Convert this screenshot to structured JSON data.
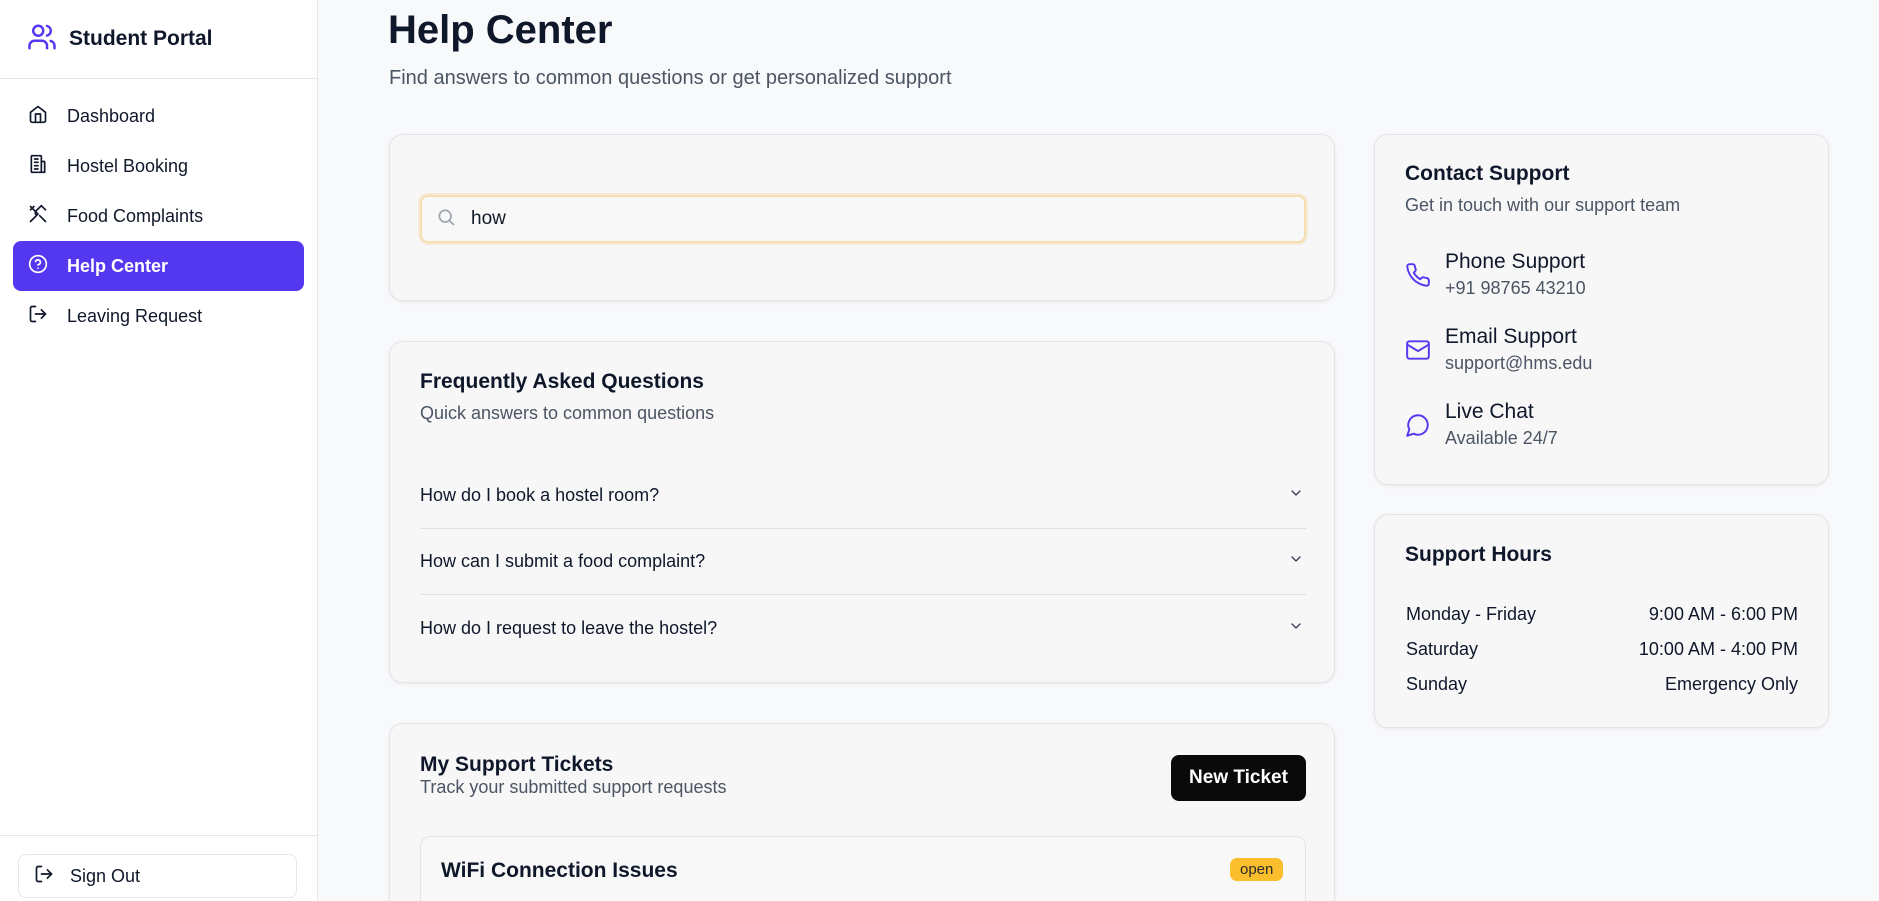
{
  "app": {
    "title": "Student Portal"
  },
  "colors": {
    "accent": "#5438f0",
    "badge_open": "#fbbf2e"
  },
  "sidebar": {
    "items": [
      {
        "label": "Dashboard",
        "icon": "home-icon",
        "active": false
      },
      {
        "label": "Hostel Booking",
        "icon": "building-icon",
        "active": false
      },
      {
        "label": "Food Complaints",
        "icon": "utensils-crossed-icon",
        "active": false
      },
      {
        "label": "Help Center",
        "icon": "help-circle-icon",
        "active": true
      },
      {
        "label": "Leaving Request",
        "icon": "log-out-icon",
        "active": false
      }
    ],
    "signout_label": "Sign Out"
  },
  "header": {
    "title": "Help Center",
    "subtitle": "Find answers to common questions or get personalized support"
  },
  "search": {
    "value": "how"
  },
  "faq": {
    "title": "Frequently Asked Questions",
    "subtitle": "Quick answers to common questions",
    "items": [
      "How do I book a hostel room?",
      "How can I submit a food complaint?",
      "How do I request to leave the hostel?"
    ]
  },
  "tickets": {
    "title": "My Support Tickets",
    "subtitle": "Track your submitted support requests",
    "new_button": "New Ticket",
    "items": [
      {
        "title": "WiFi Connection Issues",
        "status": "open"
      }
    ]
  },
  "contact": {
    "title": "Contact Support",
    "subtitle": "Get in touch with our support team",
    "items": [
      {
        "name": "Phone Support",
        "detail": "+91 98765 43210",
        "icon": "phone-icon"
      },
      {
        "name": "Email Support",
        "detail": "support@hms.edu",
        "icon": "mail-icon"
      },
      {
        "name": "Live Chat",
        "detail": "Available 24/7",
        "icon": "message-circle-icon"
      }
    ]
  },
  "hours": {
    "title": "Support Hours",
    "rows": [
      {
        "day": "Monday - Friday",
        "time": "9:00 AM - 6:00 PM"
      },
      {
        "day": "Saturday",
        "time": "10:00 AM - 4:00 PM"
      },
      {
        "day": "Sunday",
        "time": "Emergency Only"
      }
    ]
  }
}
